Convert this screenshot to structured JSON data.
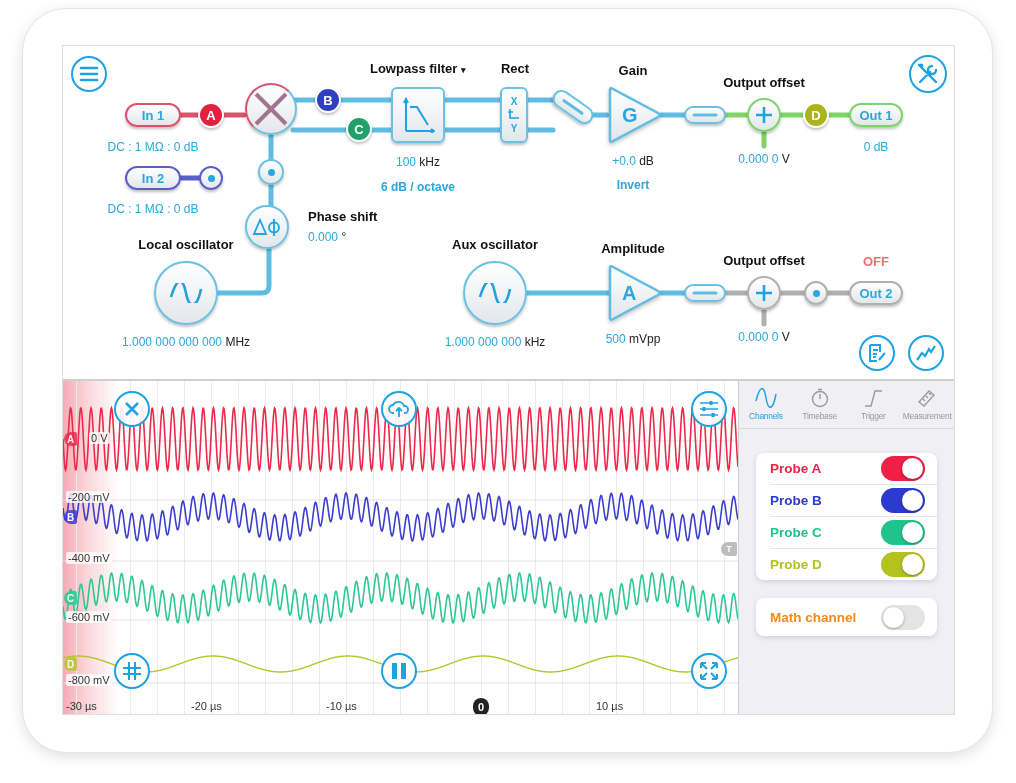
{
  "diagram": {
    "inputs": [
      {
        "label": "In 1",
        "setting": "DC : 1 MΩ : 0 dB",
        "color": "#d9536a"
      },
      {
        "label": "In 2",
        "setting": "DC : 1 MΩ : 0 dB",
        "color": "#5a5fc8"
      }
    ],
    "probe_badges": [
      {
        "letter": "A",
        "color": "#e0223f"
      },
      {
        "letter": "B",
        "color": "#2f3fc0"
      },
      {
        "letter": "C",
        "color": "#22a06b"
      },
      {
        "letter": "D",
        "color": "#a8b41a"
      }
    ],
    "filter": {
      "title": "Lowpass filter",
      "caret": "▾",
      "cutoff": "100",
      "cutoff_unit": "kHz",
      "slope": "6 dB / octave"
    },
    "rect": {
      "title": "Rect",
      "top": "X",
      "bottom": "Y"
    },
    "gain": {
      "title": "Gain",
      "symbol": "G",
      "value": "+0.0",
      "unit": "dB",
      "option": "Invert"
    },
    "phase": {
      "title": "Phase shift",
      "value": "0.000",
      "unit": "°"
    },
    "local_oscillator": {
      "title": "Local oscillator",
      "value": "1.000 000 000 000",
      "unit": "MHz"
    },
    "aux_oscillator": {
      "title": "Aux oscillator",
      "value": "1.000 000 000",
      "unit": "kHz"
    },
    "amplitude": {
      "title": "Amplitude",
      "symbol": "A",
      "value": "500",
      "unit": "mVpp"
    },
    "outputs": [
      {
        "offset_title": "Output offset",
        "offset_value": "0.000 0",
        "offset_unit": "V",
        "label": "Out 1",
        "note_below": "0 dB",
        "on": true
      },
      {
        "offset_title": "Output offset",
        "offset_value": "0.000 0",
        "offset_unit": "V",
        "label": "Out 2",
        "note_above": "OFF",
        "on": false
      }
    ]
  },
  "scope": {
    "y_labels": [
      "0 V",
      "-200 mV",
      "-400 mV",
      "-600 mV",
      "-800 mV"
    ],
    "x_labels": [
      "-30 µs",
      "-20 µs",
      "-10 µs",
      "10 µs"
    ],
    "trigger_time": "0",
    "trigger_level": "T",
    "traces": [
      {
        "marker": "A",
        "color": "#ee2a4a",
        "kind": "carrier"
      },
      {
        "marker": "B",
        "color": "#3b3fd0",
        "kind": "modulated"
      },
      {
        "marker": "C",
        "color": "#2ec795",
        "kind": "modulated_shifted"
      },
      {
        "marker": "D",
        "color": "#b4c72a",
        "kind": "slow"
      }
    ]
  },
  "panel": {
    "tabs": [
      {
        "label": "Channels",
        "selected": true
      },
      {
        "label": "Timebase",
        "selected": false
      },
      {
        "label": "Trigger",
        "selected": false
      },
      {
        "label": "Measurement",
        "selected": false
      }
    ],
    "probes": [
      {
        "label": "Probe A",
        "color": "#ef1f45",
        "on": true
      },
      {
        "label": "Probe B",
        "color": "#2c3ad0",
        "on": true
      },
      {
        "label": "Probe C",
        "color": "#1fc38b",
        "on": true
      },
      {
        "label": "Probe D",
        "color": "#b3c21f",
        "on": true
      }
    ],
    "math": {
      "label": "Math channel",
      "on": false
    }
  }
}
